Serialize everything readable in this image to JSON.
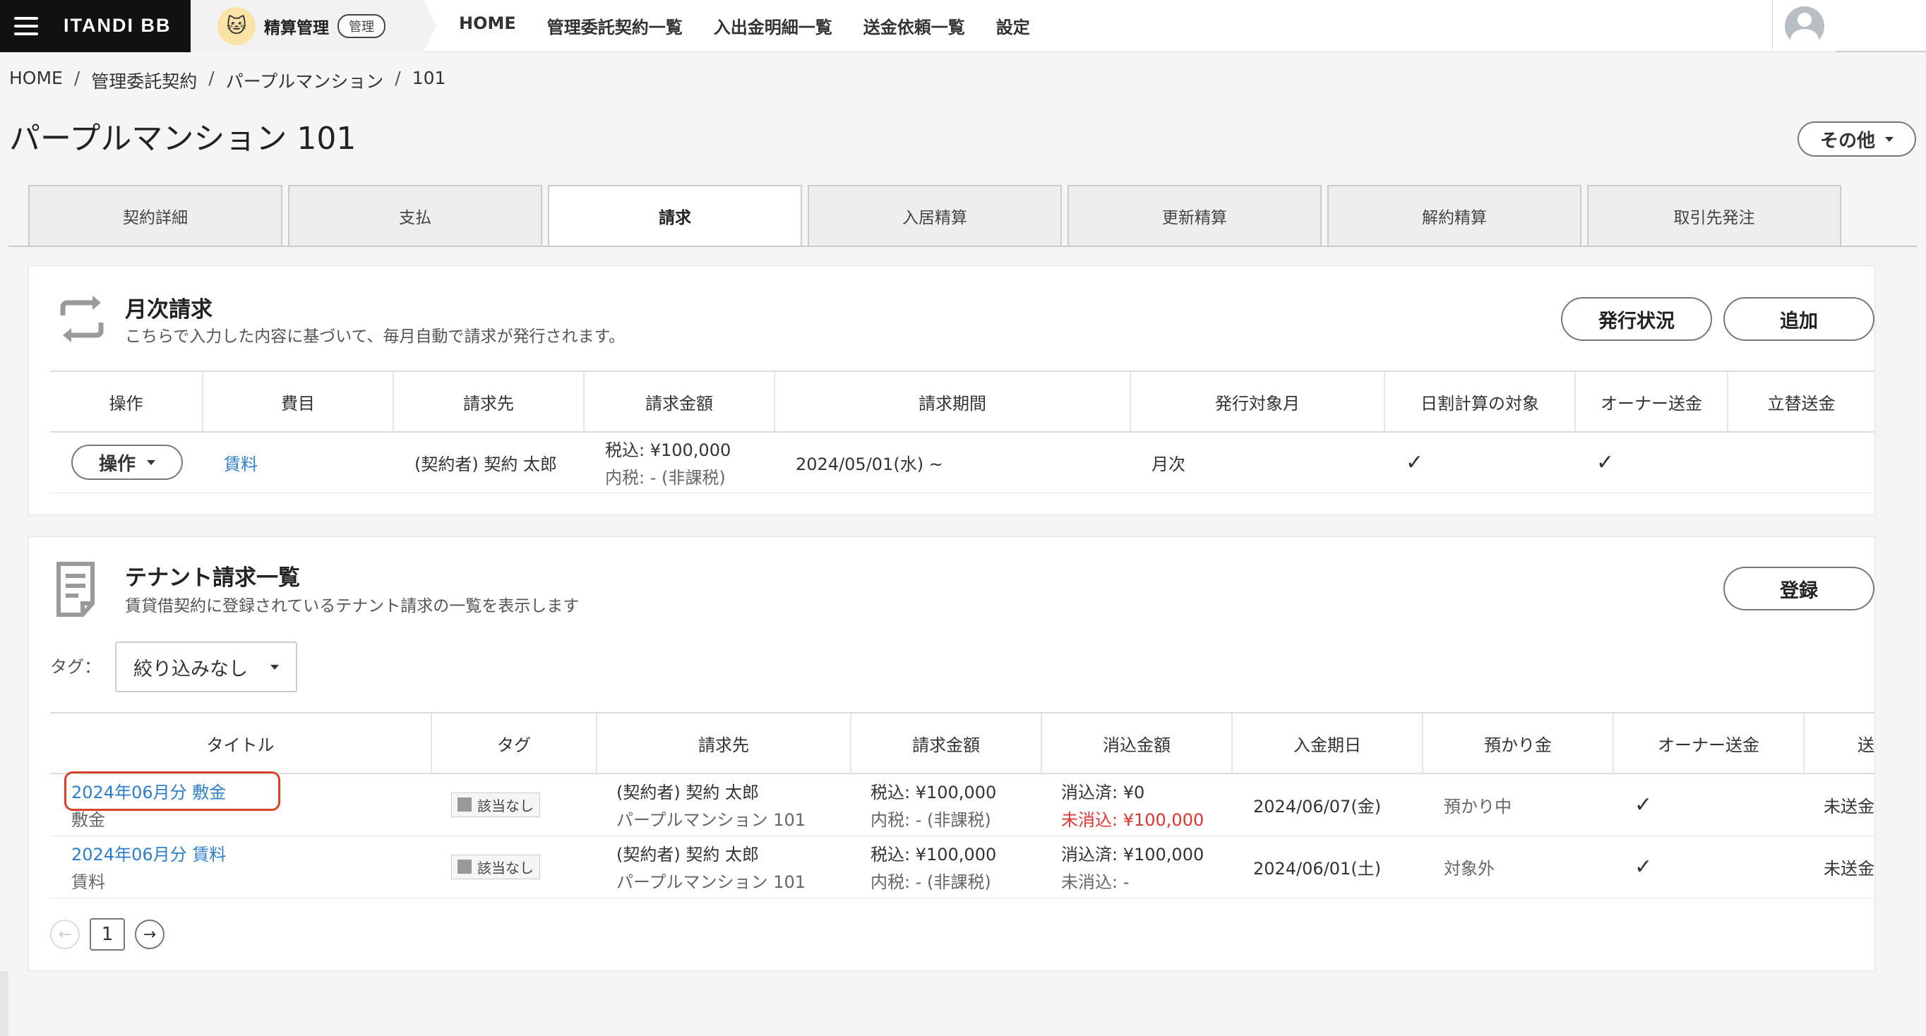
{
  "header": {
    "brand": "ITANDI BB",
    "app_name": "精算管理",
    "app_badge": "管理",
    "nav": [
      "HOME",
      "管理委託契約一覧",
      "入出金明細一覧",
      "送金依頼一覧",
      "設定"
    ]
  },
  "breadcrumb": [
    "HOME",
    "管理委託契約",
    "パープルマンション",
    "101"
  ],
  "page": {
    "title": "パープルマンション 101",
    "more_label": "その他"
  },
  "tabs": [
    "契約詳細",
    "支払",
    "請求",
    "入居精算",
    "更新精算",
    "解約精算",
    "取引先発注"
  ],
  "active_tab": "請求",
  "monthly": {
    "title": "月次請求",
    "desc": "こちらで入力した内容に基づいて、毎月自動で請求が発行されます。",
    "btn_status": "発行状況",
    "btn_add": "追加",
    "columns": [
      "操作",
      "費目",
      "請求先",
      "請求金額",
      "請求期間",
      "発行対象月",
      "日割計算の対象",
      "オーナー送金",
      "立替送金"
    ],
    "row": {
      "op": "操作",
      "item": "賃料",
      "payer": "(契約者) 契約 太郎",
      "amount_tax": "税込: ¥100,000",
      "amount_note": "内税: - (非課税)",
      "period": "2024/05/01(水) ~",
      "month": "月次",
      "prorate": "✓",
      "owner": "✓",
      "advance": ""
    }
  },
  "tenant": {
    "title": "テナント請求一覧",
    "desc": "賃貸借契約に登録されているテナント請求の一覧を表示します",
    "btn_register": "登録",
    "tag_label": "タグ：",
    "tag_filter": "絞り込みなし",
    "columns": [
      "タイトル",
      "タグ",
      "請求先",
      "請求金額",
      "消込金額",
      "入金期日",
      "預かり金",
      "オーナー送金",
      "送"
    ],
    "rows": [
      {
        "title": "2024年06月分 敷金",
        "sub": "敷金",
        "tag": "該当なし",
        "payer": "(契約者) 契約 太郎",
        "property": "パープルマンション 101",
        "amount_tax": "税込: ¥100,000",
        "amount_note": "内税: - (非課税)",
        "cleared": "消込済: ¥0",
        "uncleared": "未消込: ¥100,000",
        "due": "2024/06/07(金)",
        "deposit": "預かり中",
        "owner": "✓",
        "send": "未送金"
      },
      {
        "title": "2024年06月分 賃料",
        "sub": "賃料",
        "tag": "該当なし",
        "payer": "(契約者) 契約 太郎",
        "property": "パープルマンション 101",
        "amount_tax": "税込: ¥100,000",
        "amount_note": "内税: - (非課税)",
        "cleared": "消込済: ¥100,000",
        "uncleared": "未消込: -",
        "due": "2024/06/01(土)",
        "deposit": "対象外",
        "owner": "✓",
        "send": "未送金"
      }
    ],
    "page": "1"
  },
  "icons": {
    "prev": "arrow-left-icon",
    "next": "arrow-right-icon",
    "refresh": "refresh-icon",
    "document": "document-icon"
  }
}
